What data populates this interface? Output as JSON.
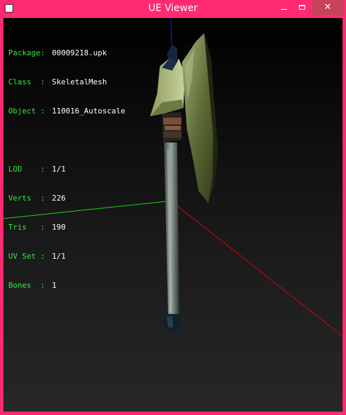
{
  "window": {
    "title": "UE Viewer"
  },
  "controls": {
    "minimize": "minimize-icon",
    "maximize": "maximize-icon",
    "close": "✕"
  },
  "colors": {
    "frame": "#ff2a70",
    "info_label": "#39e739",
    "info_value": "#ffffff",
    "axis_x": "#ff0000",
    "axis_y": "#00ff00",
    "axis_z": "#0000ff"
  },
  "info": {
    "package_label": "Package:",
    "package_value": "00009218.upk",
    "class_label": "Class  :",
    "class_value": "SkeletalMesh",
    "object_label": "Object :",
    "object_value": "110016_Autoscale",
    "lod_label": "LOD    :",
    "lod_value": "1/1",
    "verts_label": "Verts  :",
    "verts_value": "226",
    "tris_label": "Tris   :",
    "tris_value": "190",
    "uvset_label": "UV Set :",
    "uvset_value": "1/1",
    "bones_label": "Bones  :",
    "bones_value": "1"
  }
}
